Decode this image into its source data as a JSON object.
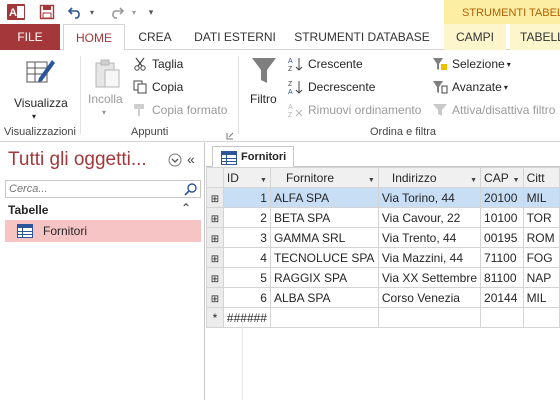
{
  "app": {
    "icon_letter": "A",
    "context_title": "STRUMENTI TABELLA"
  },
  "quick_access": {
    "save_icon": "save-icon",
    "undo_icon": "undo-icon",
    "redo_icon": "redo-icon",
    "customize_icon": "customize-icon"
  },
  "tabs": {
    "file": "FILE",
    "home": "HOME",
    "crea": "CREA",
    "dati_esterni": "DATI ESTERNI",
    "strumenti_database": "STRUMENTI DATABASE",
    "campi": "CAMPI",
    "tabella": "TABELLA"
  },
  "ribbon": {
    "views": {
      "view_label": "Visualizza",
      "group_label": "Visualizzazioni"
    },
    "clipboard": {
      "paste_label": "Incolla",
      "cut_label": "Taglia",
      "copy_label": "Copia",
      "format_painter_label": "Copia formato",
      "group_label": "Appunti"
    },
    "sort_filter": {
      "filter_label": "Filtro",
      "ascending_label": "Crescente",
      "descending_label": "Decrescente",
      "remove_sort_label": "Rimuovi ordinamento",
      "selection_label": "Selezione",
      "advanced_label": "Avanzate",
      "toggle_filter_label": "Attiva/disattiva filtro",
      "group_label": "Ordina e filtra"
    }
  },
  "nav_pane": {
    "title": "Tutti gli oggetti...",
    "search_placeholder": "Cerca...",
    "group_label": "Tabelle",
    "items": [
      {
        "label": "Fornitori"
      }
    ]
  },
  "document": {
    "tab_label": "Fornitori",
    "columns": [
      "ID",
      "Fornitore",
      "Indirizzo",
      "CAP",
      "Citt"
    ],
    "rows": [
      {
        "id": "1",
        "fornitore": "ALFA SPA",
        "indirizzo": "Via Torino, 44",
        "cap": "20100",
        "citta": "MIL"
      },
      {
        "id": "2",
        "fornitore": "BETA SPA",
        "indirizzo": "Via Cavour, 22",
        "cap": "10100",
        "citta": "TOR"
      },
      {
        "id": "3",
        "fornitore": "GAMMA SRL",
        "indirizzo": "Via Trento, 44",
        "cap": "00195",
        "citta": "ROM"
      },
      {
        "id": "4",
        "fornitore": "TECNOLUCE SPA",
        "indirizzo": "Via Mazzini, 44",
        "cap": "71100",
        "citta": "FOG"
      },
      {
        "id": "5",
        "fornitore": "RAGGIX SPA",
        "indirizzo": "Via XX Settembre",
        "cap": "81100",
        "citta": "NAP"
      },
      {
        "id": "6",
        "fornitore": "ALBA SPA",
        "indirizzo": "Corso Venezia",
        "cap": "20144",
        "citta": "MIL"
      }
    ],
    "new_row": {
      "marker": "*",
      "id_placeholder": "######"
    },
    "selected_row_index": 0
  },
  "colors": {
    "accent": "#a4373a",
    "context_tab_bg": "#fcefa3",
    "context_text": "#b45f06",
    "nav_selected": "#f6c4c5",
    "row_selected": "#c8def5"
  }
}
